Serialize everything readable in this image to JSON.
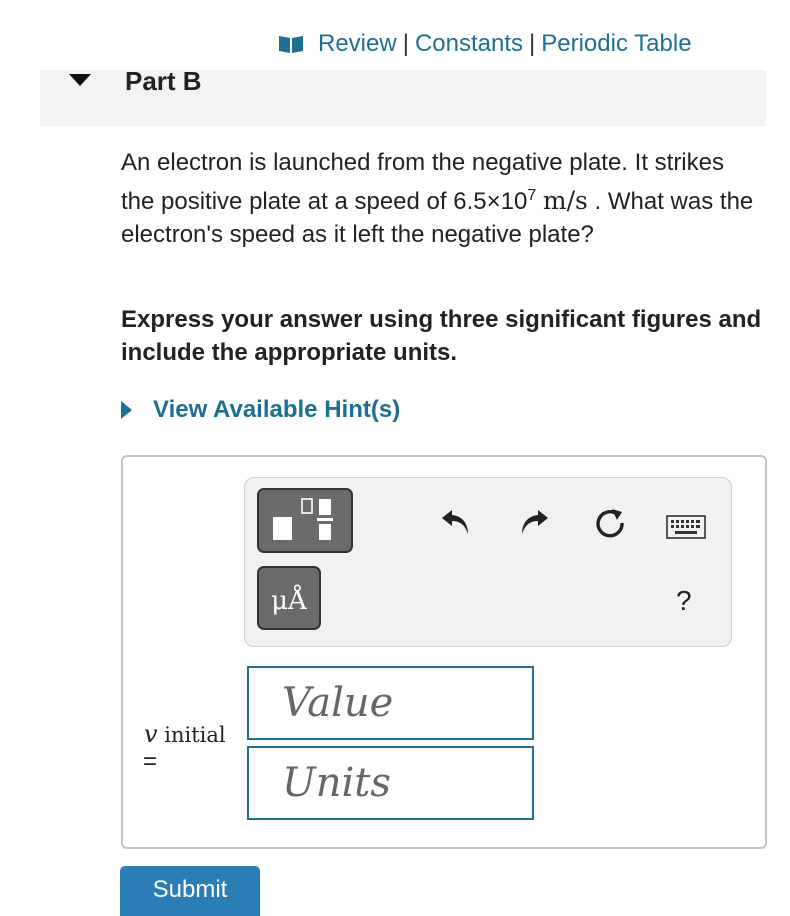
{
  "top_links": {
    "review": "Review",
    "constants": "Constants",
    "periodic_table": "Periodic Table",
    "separator": "|"
  },
  "part": {
    "title": "Part B"
  },
  "question": {
    "text1": "An electron is launched from the negative plate. It strikes the positive plate at a speed of 6.5×10",
    "exponent": "7",
    "unit": "m/s",
    "text2": ". What was the electron's speed as it left the negative plate?"
  },
  "instruction": "Express your answer using three significant figures and include the appropriate units.",
  "hint": {
    "label": "View Available Hint(s)"
  },
  "toolbar": {
    "unit_button_label": "μÅ",
    "help_label": "?",
    "icons": [
      "templates-icon",
      "units-icon",
      "undo-icon",
      "redo-icon",
      "reset-icon",
      "keyboard-icon",
      "help-icon"
    ]
  },
  "answer": {
    "variable": "v",
    "variable_subscript": "initial",
    "equals": "=",
    "value_placeholder": "Value",
    "units_placeholder": "Units"
  },
  "submit": {
    "label": "Submit"
  },
  "colors": {
    "accent": "#1f6e94",
    "button": "#2b7db6",
    "toolbar_button": "#6b6b6b"
  }
}
